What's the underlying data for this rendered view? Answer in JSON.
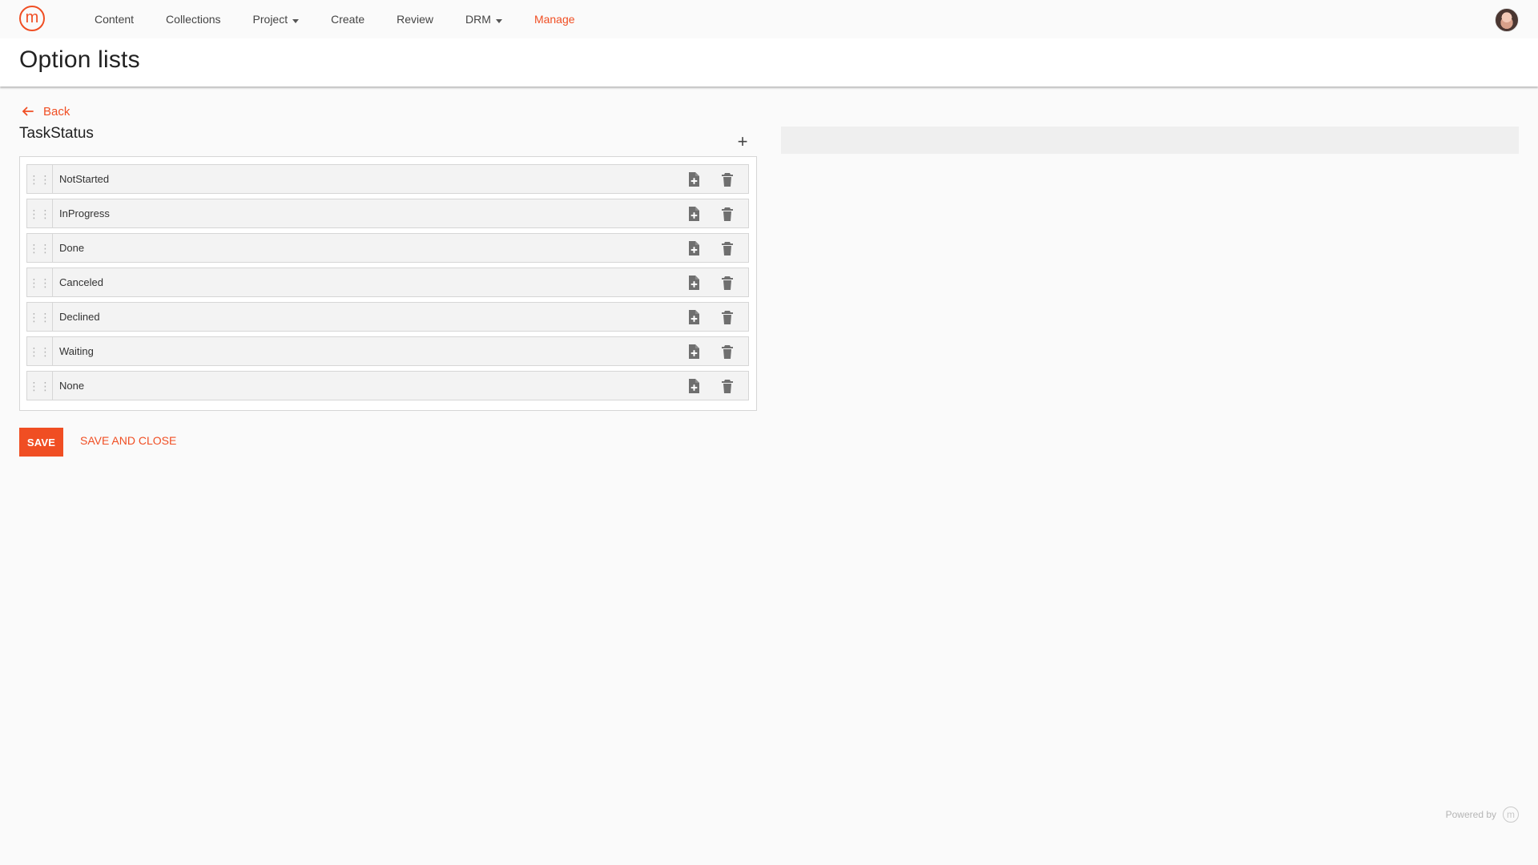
{
  "app": {
    "logo_text": "m"
  },
  "nav": {
    "items": [
      {
        "label": "Content"
      },
      {
        "label": "Collections"
      },
      {
        "label": "Project"
      },
      {
        "label": "Create"
      },
      {
        "label": "Review"
      },
      {
        "label": "DRM"
      },
      {
        "label": "Manage"
      }
    ],
    "active_label": "Manage"
  },
  "page": {
    "title": "Option lists",
    "back_label": "Back"
  },
  "list": {
    "name": "TaskStatus",
    "add_symbol": "+",
    "items": [
      {
        "value": "NotStarted"
      },
      {
        "value": "InProgress"
      },
      {
        "value": "Done"
      },
      {
        "value": "Canceled"
      },
      {
        "value": "Declined"
      },
      {
        "value": "Waiting"
      },
      {
        "value": "None"
      }
    ]
  },
  "actions": {
    "save_label": "SAVE",
    "save_and_close_label": "SAVE AND CLOSE"
  },
  "footer": {
    "powered_by_label": "Powered by",
    "powered_logo_text": "m"
  },
  "colors": {
    "accent": "#f04e23",
    "icon_gray": "#6f6f6f"
  },
  "icons": {
    "back": "arrow-left-icon",
    "add": "plus-icon",
    "drag": "drag-handle-icon",
    "add_file": "add-file-icon",
    "delete": "trash-icon"
  }
}
